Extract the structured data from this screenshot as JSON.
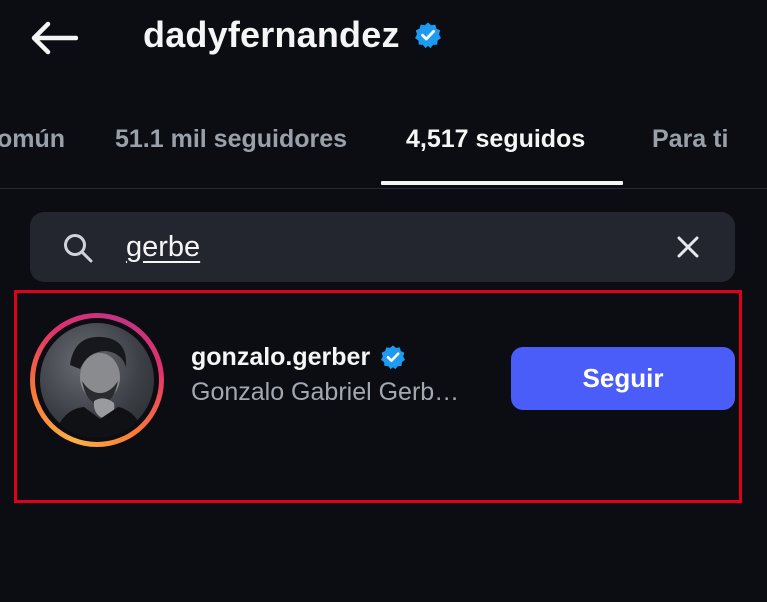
{
  "header": {
    "title": "dadyfernandez",
    "verified": true,
    "back_icon": "arrow-left-icon"
  },
  "tabs": [
    {
      "label": "omún",
      "active": false
    },
    {
      "label": "51.1 mil seguidores",
      "active": false
    },
    {
      "label": "4,517 seguidos",
      "active": true
    },
    {
      "label": "Para ti",
      "active": false
    }
  ],
  "search": {
    "value": "gerbe",
    "icon": "search-icon",
    "clear_icon": "close-icon"
  },
  "results": [
    {
      "username": "gonzalo.gerber",
      "verified": true,
      "full_name": "Gonzalo Gabriel Gerb…",
      "follow_label": "Seguir"
    }
  ],
  "colors": {
    "background": "#0b0d13",
    "verified_badge": "#1d9bf0",
    "follow_button": "#4a5df9",
    "highlight_border": "#e0001b",
    "search_bg": "#23262e"
  }
}
